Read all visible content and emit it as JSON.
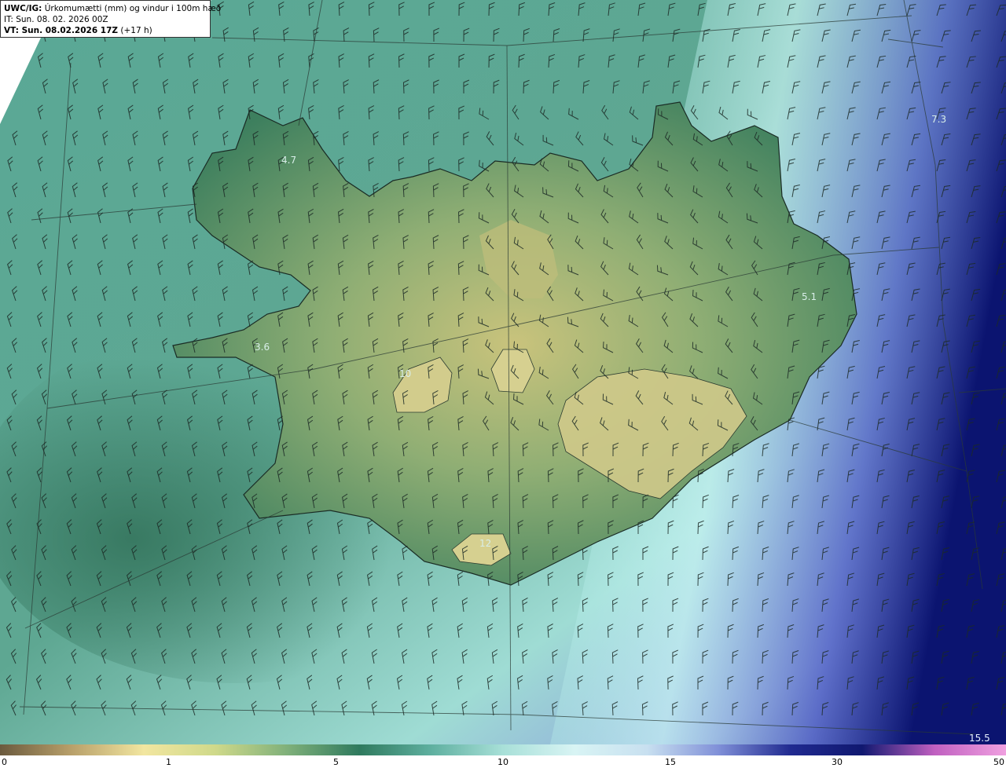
{
  "header": {
    "model": "UWC/IG:",
    "title": " Úrkomumætti (mm) og vindur i 100m hæð",
    "initial_time": "IT: Sun. 08. 02. 2026 00Z",
    "valid_prefix": "VT: Sun. 08.02.2026 17Z",
    "valid_suffix": " (+17 h)"
  },
  "map_labels": [
    {
      "text": "4.7"
    },
    {
      "text": "3.6"
    },
    {
      "text": "5.1"
    },
    {
      "text": "7.3"
    },
    {
      "text": "10"
    },
    {
      "text": "12"
    }
  ],
  "corner_value": "15.5",
  "colorbar": {
    "ticks": [
      "0",
      "1",
      "5",
      "10",
      "15",
      "30",
      "50"
    ],
    "colors": [
      "#6b5a3e",
      "#b8a06a",
      "#f2e6a0",
      "#cfd98a",
      "#7fb07a",
      "#2f7a5e",
      "#5fb0a0",
      "#a8e0d8",
      "#d8f4f4",
      "#c8e0f0",
      "#8090d8",
      "#202a90",
      "#101870",
      "#c060c0",
      "#f0a0e0"
    ]
  },
  "colors": {
    "ocean_mid": "#7ec8bc",
    "ocean_dark": "#3c8f7c",
    "land_green": "#3d7f5e",
    "land_yellow": "#c6c77e",
    "deep_blue": "#0e1a7a"
  },
  "icons": [
    "wind-barb-icon"
  ]
}
